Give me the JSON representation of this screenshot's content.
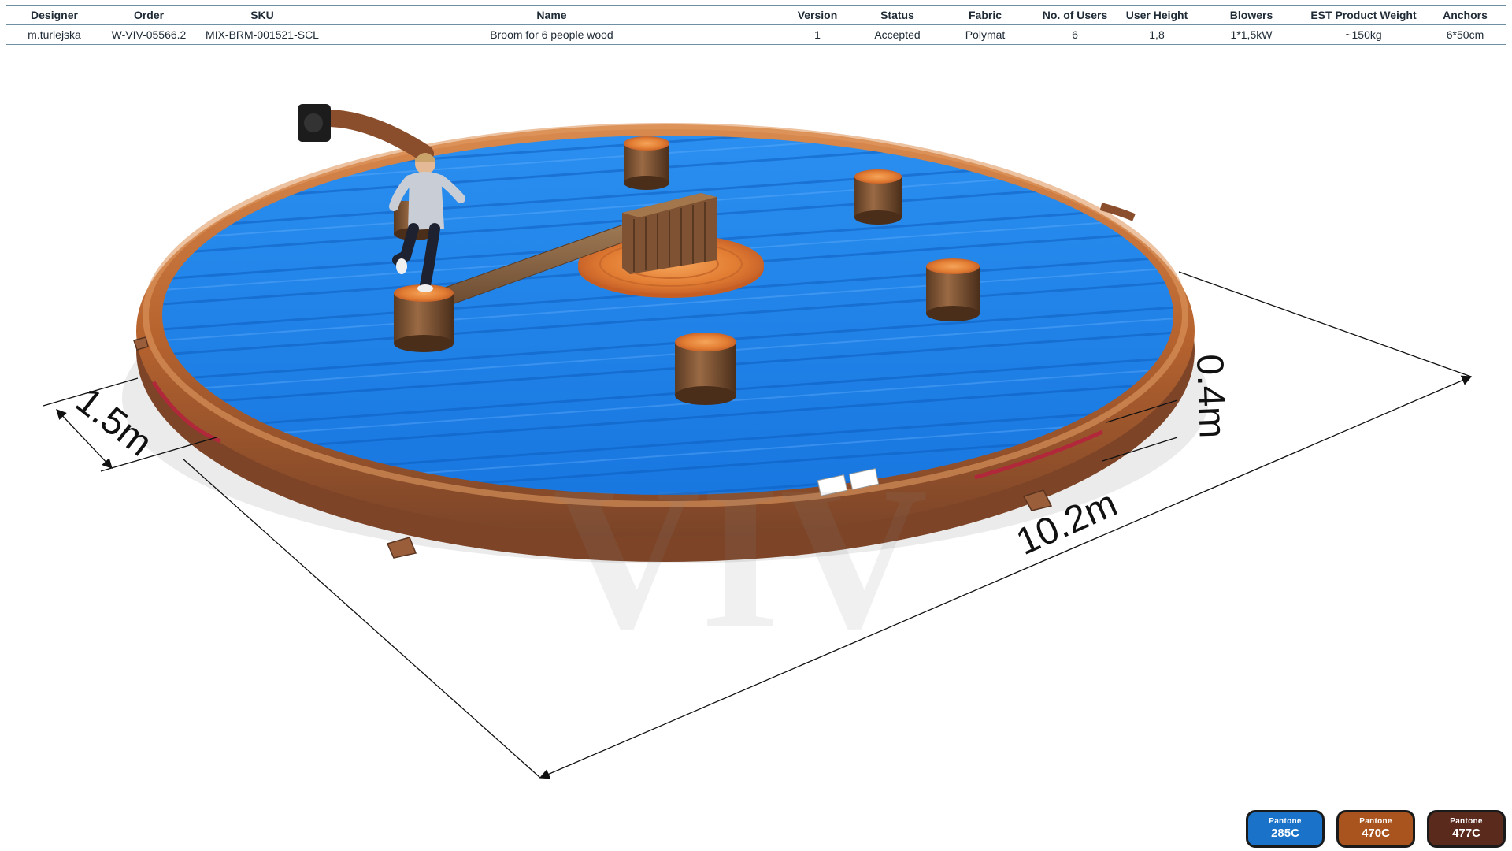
{
  "spec": {
    "headers": [
      "Designer",
      "Order",
      "SKU",
      "Name",
      "Version",
      "Status",
      "Fabric",
      "No. of Users",
      "User  Height",
      "Blowers",
      "EST Product Weight",
      "Anchors"
    ],
    "row": [
      "m.turlejska",
      "W-VIV-05566.2",
      "MIX-BRM-001521-SCL",
      "Broom for 6 people wood",
      "1",
      "Accepted",
      "Polymat",
      "6",
      "1,8",
      "1*1,5kW",
      "~150kg",
      "6*50cm"
    ]
  },
  "dimensions": {
    "diameter": "10.2m",
    "height": "0.4m",
    "wall_width": "1.5m"
  },
  "watermark": "VIV",
  "pantone": [
    {
      "label": "Pantone",
      "code": "285C",
      "color": "#1b73c9"
    },
    {
      "label": "Pantone",
      "code": "470C",
      "color": "#a9541e"
    },
    {
      "label": "Pantone",
      "code": "477C",
      "color": "#5a2a1d"
    }
  ],
  "colors": {
    "mat_blue": "#1f8df2",
    "rim_orange": "#c46d34",
    "rim_brown": "#8a4a2a",
    "wood": "#8b5a2b"
  }
}
